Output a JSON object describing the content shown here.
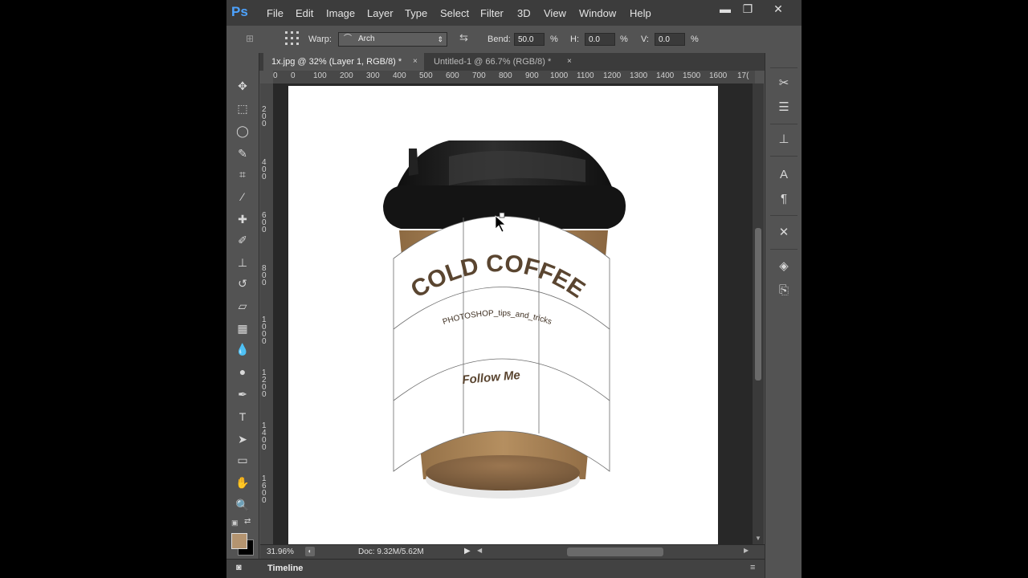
{
  "app": {
    "logo": "Ps"
  },
  "menu": [
    "File",
    "Edit",
    "Image",
    "Layer",
    "Type",
    "Select",
    "Filter",
    "3D",
    "View",
    "Window",
    "Help"
  ],
  "window_controls": {
    "minimize": "▬",
    "maximize": "❐",
    "close": "✕"
  },
  "options": {
    "warp_label": "Warp:",
    "warp_style": "Arch",
    "bend_label": "Bend:",
    "bend_value": "50.0",
    "h_label": "H:",
    "h_value": "0.0",
    "v_label": "V:",
    "v_value": "0.0",
    "percent": "%"
  },
  "tabs": [
    {
      "label": "1x.jpg @ 32% (Layer 1, RGB/8) *",
      "close": "×"
    },
    {
      "label": "Untitled-1 @ 66.7% (RGB/8) *",
      "close": "×"
    }
  ],
  "ruler_h": [
    "0",
    "0",
    "100",
    "200",
    "300",
    "400",
    "500",
    "600",
    "700",
    "800",
    "900",
    "1000",
    "1100",
    "1200",
    "1300",
    "1400",
    "1500",
    "1600",
    "17("
  ],
  "ruler_v": [
    "200",
    "400",
    "600",
    "800",
    "1000",
    "1200",
    "1400",
    "1600"
  ],
  "artwork": {
    "title": "COLD COFFEE",
    "subtitle": "PHOTOSHOP_tips_and_tricks",
    "tagline": "Follow Me"
  },
  "status": {
    "zoom": "31.96%",
    "doc": "Doc: 9.32M/5.62M"
  },
  "timeline": {
    "label": "Timeline"
  },
  "colors": {
    "foreground": "#b49470",
    "background": "#000000",
    "cup_sleeve": "#a67c4c",
    "coffee": "#8a6a44",
    "lid": "#1b1b1b",
    "text_brown": "#5a4530",
    "ps_blue": "#4da3ff"
  },
  "tools": [
    "move-tool-icon",
    "marquee-tool-icon",
    "lasso-tool-icon",
    "quick-select-tool-icon",
    "crop-tool-icon",
    "eyedropper-tool-icon",
    "healing-brush-tool-icon",
    "brush-tool-icon",
    "clone-stamp-tool-icon",
    "history-brush-tool-icon",
    "eraser-tool-icon",
    "gradient-tool-icon",
    "blur-tool-icon",
    "dodge-tool-icon",
    "pen-tool-icon",
    "type-tool-icon",
    "path-select-tool-icon",
    "rectangle-tool-icon",
    "hand-tool-icon",
    "zoom-tool-icon"
  ]
}
